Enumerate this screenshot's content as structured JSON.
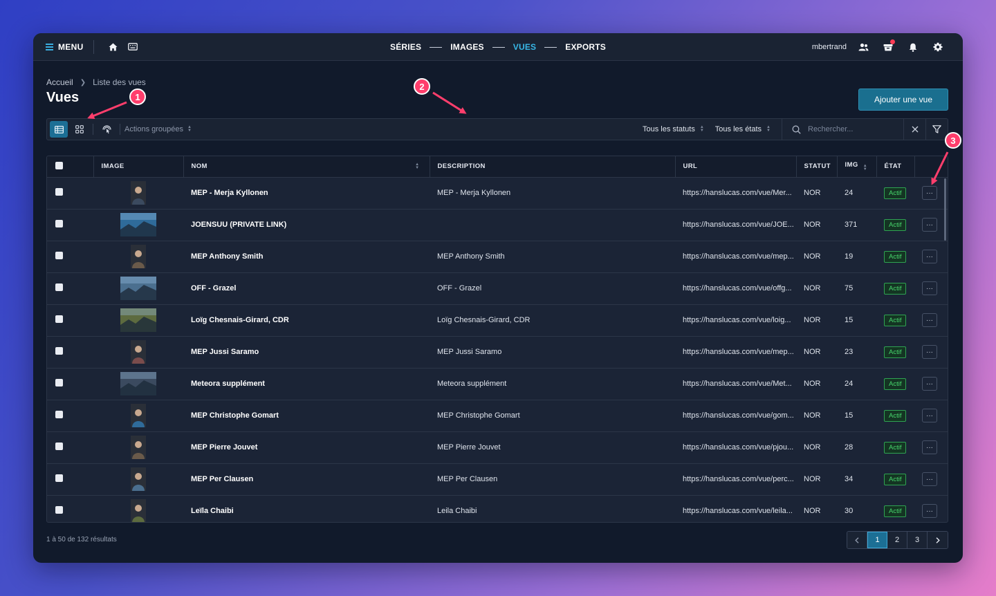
{
  "topbar": {
    "menu_label": "MENU",
    "nav": [
      {
        "label": "SÉRIES",
        "active": false
      },
      {
        "label": "IMAGES",
        "active": false
      },
      {
        "label": "VUES",
        "active": true
      },
      {
        "label": "EXPORTS",
        "active": false
      }
    ],
    "username": "mbertrand"
  },
  "breadcrumb": {
    "home": "Accueil",
    "current": "Liste des vues"
  },
  "page_title": "Vues",
  "add_button": "Ajouter une vue",
  "toolbar": {
    "bulk_actions": "Actions groupées",
    "status_filter": "Tous les statuts",
    "state_filter": "Tous les états",
    "search_placeholder": "Rechercher..."
  },
  "table": {
    "columns": {
      "image": "IMAGE",
      "nom": "NOM",
      "description": "DESCRIPTION",
      "url": "URL",
      "statut": "STATUT",
      "img": "IMG",
      "etat": "ÉTAT"
    },
    "rows": [
      {
        "nom": "MEP - Merja Kyllonen",
        "description": "MEP - Merja Kyllonen",
        "url": "https://hanslucas.com/vue/Mer...",
        "statut": "NOR",
        "img": "24",
        "etat": "Actif",
        "thumb": "portrait"
      },
      {
        "nom": "JOENSUU (PRIVATE LINK)",
        "description": "",
        "url": "https://hanslucas.com/vue/JOE...",
        "statut": "NOR",
        "img": "371",
        "etat": "Actif",
        "thumb": "landscape"
      },
      {
        "nom": "MEP Anthony Smith",
        "description": "MEP Anthony Smith",
        "url": "https://hanslucas.com/vue/mep...",
        "statut": "NOR",
        "img": "19",
        "etat": "Actif",
        "thumb": "portrait"
      },
      {
        "nom": "OFF - Grazel",
        "description": "OFF - Grazel",
        "url": "https://hanslucas.com/vue/offg...",
        "statut": "NOR",
        "img": "75",
        "etat": "Actif",
        "thumb": "landscape"
      },
      {
        "nom": "Loïg Chesnais-Girard, CDR",
        "description": "Loïg Chesnais-Girard, CDR",
        "url": "https://hanslucas.com/vue/loig...",
        "statut": "NOR",
        "img": "15",
        "etat": "Actif",
        "thumb": "landscape"
      },
      {
        "nom": "MEP Jussi Saramo",
        "description": "MEP Jussi Saramo",
        "url": "https://hanslucas.com/vue/mep...",
        "statut": "NOR",
        "img": "23",
        "etat": "Actif",
        "thumb": "portrait"
      },
      {
        "nom": "Meteora supplément",
        "description": "Meteora supplément",
        "url": "https://hanslucas.com/vue/Met...",
        "statut": "NOR",
        "img": "24",
        "etat": "Actif",
        "thumb": "landscape"
      },
      {
        "nom": "MEP Christophe Gomart",
        "description": "MEP Christophe Gomart",
        "url": "https://hanslucas.com/vue/gom...",
        "statut": "NOR",
        "img": "15",
        "etat": "Actif",
        "thumb": "portrait"
      },
      {
        "nom": "MEP Pierre Jouvet",
        "description": "MEP Pierre Jouvet",
        "url": "https://hanslucas.com/vue/pjou...",
        "statut": "NOR",
        "img": "28",
        "etat": "Actif",
        "thumb": "portrait"
      },
      {
        "nom": "MEP Per Clausen",
        "description": "MEP Per Clausen",
        "url": "https://hanslucas.com/vue/perc...",
        "statut": "NOR",
        "img": "34",
        "etat": "Actif",
        "thumb": "portrait"
      },
      {
        "nom": "Leïla Chaibi",
        "description": "Leila Chaibi",
        "url": "https://hanslucas.com/vue/leila...",
        "statut": "NOR",
        "img": "30",
        "etat": "Actif",
        "thumb": "portrait"
      }
    ]
  },
  "footer": {
    "result_count": "1 à 50 de 132 résultats"
  },
  "pagination": {
    "pages": [
      "1",
      "2",
      "3"
    ],
    "current": "1"
  },
  "annotations": [
    "1",
    "2",
    "3"
  ],
  "colors": {
    "accent": "#38b8e8",
    "primary_button": "#1a6f8f",
    "active_badge": "#47d66d",
    "annotation": "#ff3e6c"
  }
}
